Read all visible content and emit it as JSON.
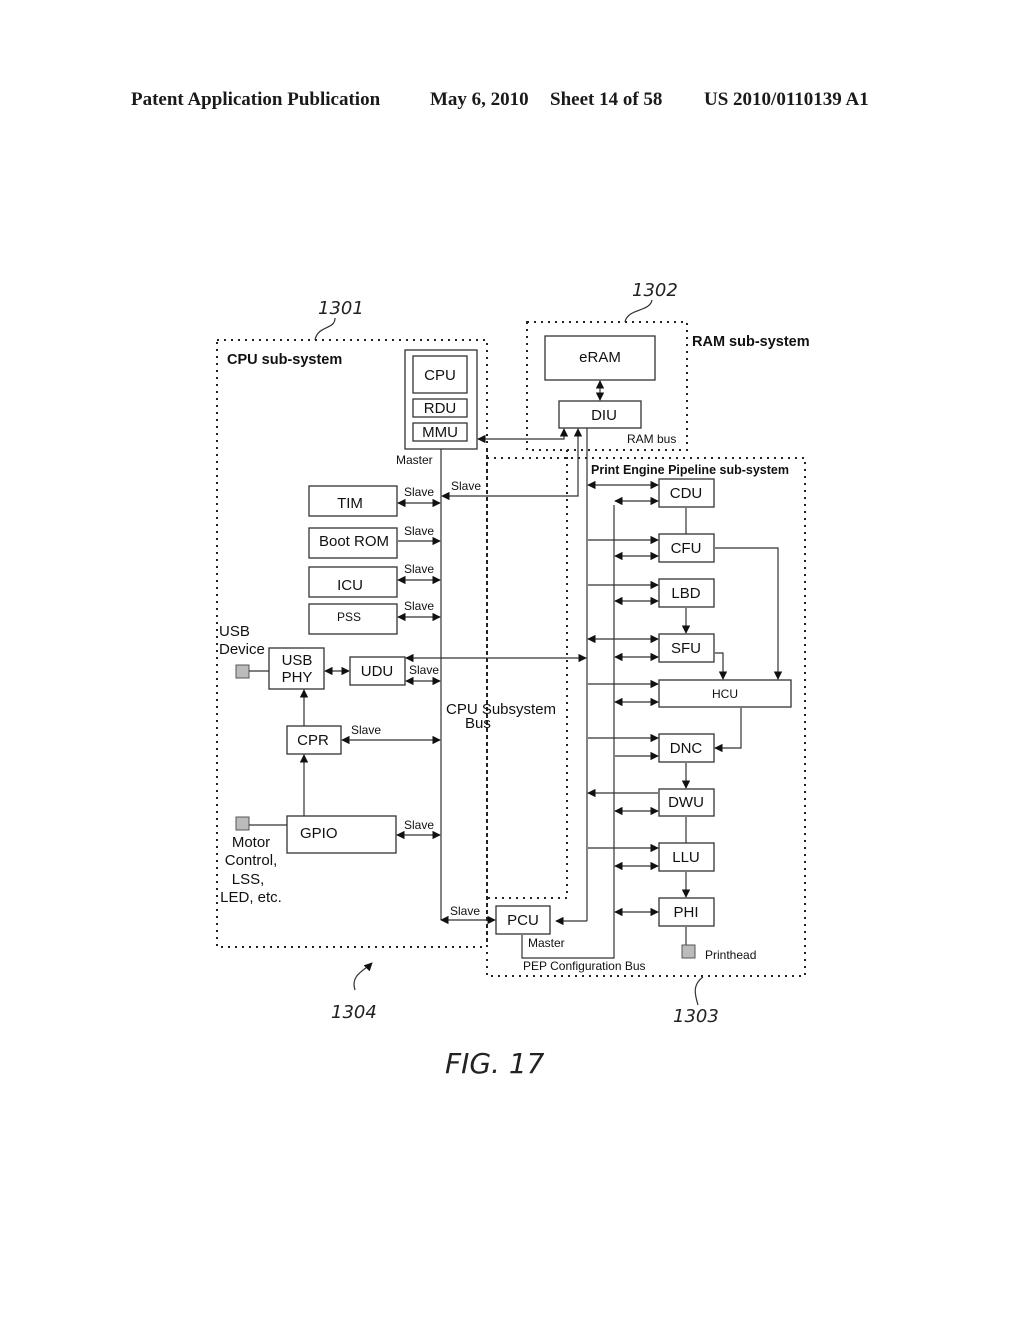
{
  "header": {
    "left": "Patent Application Publication",
    "date": "May 6, 2010",
    "sheet": "Sheet 14 of 58",
    "number": "US 2010/0110139 A1"
  },
  "figure": {
    "caption": "FIG. 17",
    "refs": {
      "cpu_sub": "1301",
      "ram_sub": "1302",
      "pep_sub": "1303",
      "cpu_bus": "1304"
    }
  },
  "cpu_subsystem": {
    "title": "CPU sub-system",
    "cpu_block": {
      "cpu": "CPU",
      "rdu": "RDU",
      "mmu": "MMU",
      "role": "Master"
    },
    "blocks": {
      "tim": "TIM",
      "boot_rom": "Boot ROM",
      "icu": "ICU",
      "pss": "PSS",
      "udu": "UDU",
      "usb_phy_line1": "USB",
      "usb_phy_line2": "PHY",
      "cpr": "CPR",
      "gpio": "GPIO"
    },
    "slave_label": "Slave",
    "bus_label_line1": "CPU Subsystem",
    "bus_label_line2": "Bus",
    "usb_device_line1": "USB",
    "usb_device_line2": "Device",
    "motor_line1": "Motor",
    "motor_line2": "Control,",
    "motor_line3": "LSS,",
    "motor_line4": "LED, etc."
  },
  "ram_subsystem": {
    "title": "RAM sub-system",
    "eram": "eRAM",
    "diu": "DIU",
    "bus_label": "RAM bus"
  },
  "pep_subsystem": {
    "title": "Print Engine Pipeline sub-system",
    "pcu": "PCU",
    "pcu_role": "Master",
    "config_bus": "PEP Configuration Bus",
    "units": [
      "CDU",
      "CFU",
      "LBD",
      "SFU",
      "HCU",
      "DNC",
      "DWU",
      "LLU",
      "PHI"
    ],
    "printhead": "Printhead"
  }
}
